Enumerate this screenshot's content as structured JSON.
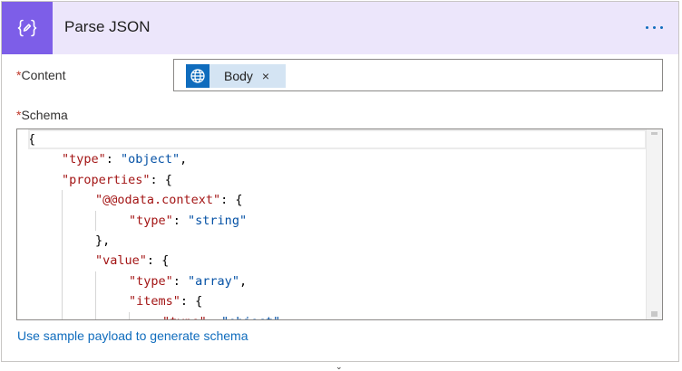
{
  "action": {
    "title": "Parse JSON",
    "icon": "curly-braces-icon",
    "accent_color": "#7d5ee8",
    "header_color": "#ece6fb"
  },
  "fields": {
    "content": {
      "required_mark": "*",
      "label": "Content",
      "token": {
        "label": "Body",
        "icon": "globe-icon",
        "remove_symbol": "×"
      }
    },
    "schema": {
      "required_mark": "*",
      "label": "Schema",
      "lines": [
        [
          {
            "t": "p",
            "v": "{"
          }
        ],
        [
          {
            "t": "k",
            "v": "\"type\""
          },
          {
            "t": "p",
            "v": ": "
          },
          {
            "t": "s",
            "v": "\"object\""
          },
          {
            "t": "p",
            "v": ","
          }
        ],
        [
          {
            "t": "k",
            "v": "\"properties\""
          },
          {
            "t": "p",
            "v": ": {"
          }
        ],
        [
          {
            "t": "k",
            "v": "\"@@odata.context\""
          },
          {
            "t": "p",
            "v": ": {"
          }
        ],
        [
          {
            "t": "k",
            "v": "\"type\""
          },
          {
            "t": "p",
            "v": ": "
          },
          {
            "t": "s",
            "v": "\"string\""
          }
        ],
        [
          {
            "t": "p",
            "v": "},"
          }
        ],
        [
          {
            "t": "k",
            "v": "\"value\""
          },
          {
            "t": "p",
            "v": ": {"
          }
        ],
        [
          {
            "t": "k",
            "v": "\"type\""
          },
          {
            "t": "p",
            "v": ": "
          },
          {
            "t": "s",
            "v": "\"array\""
          },
          {
            "t": "p",
            "v": ","
          }
        ],
        [
          {
            "t": "k",
            "v": "\"items\""
          },
          {
            "t": "p",
            "v": ": {"
          }
        ],
        [
          {
            "t": "k",
            "v": "\"type\""
          },
          {
            "t": "p",
            "v": ": "
          },
          {
            "t": "s",
            "v": "\"object\""
          }
        ]
      ],
      "indents": [
        0,
        1,
        1,
        2,
        3,
        2,
        2,
        3,
        3,
        4
      ]
    }
  },
  "links": {
    "sample_payload": "Use sample payload to generate schema"
  }
}
